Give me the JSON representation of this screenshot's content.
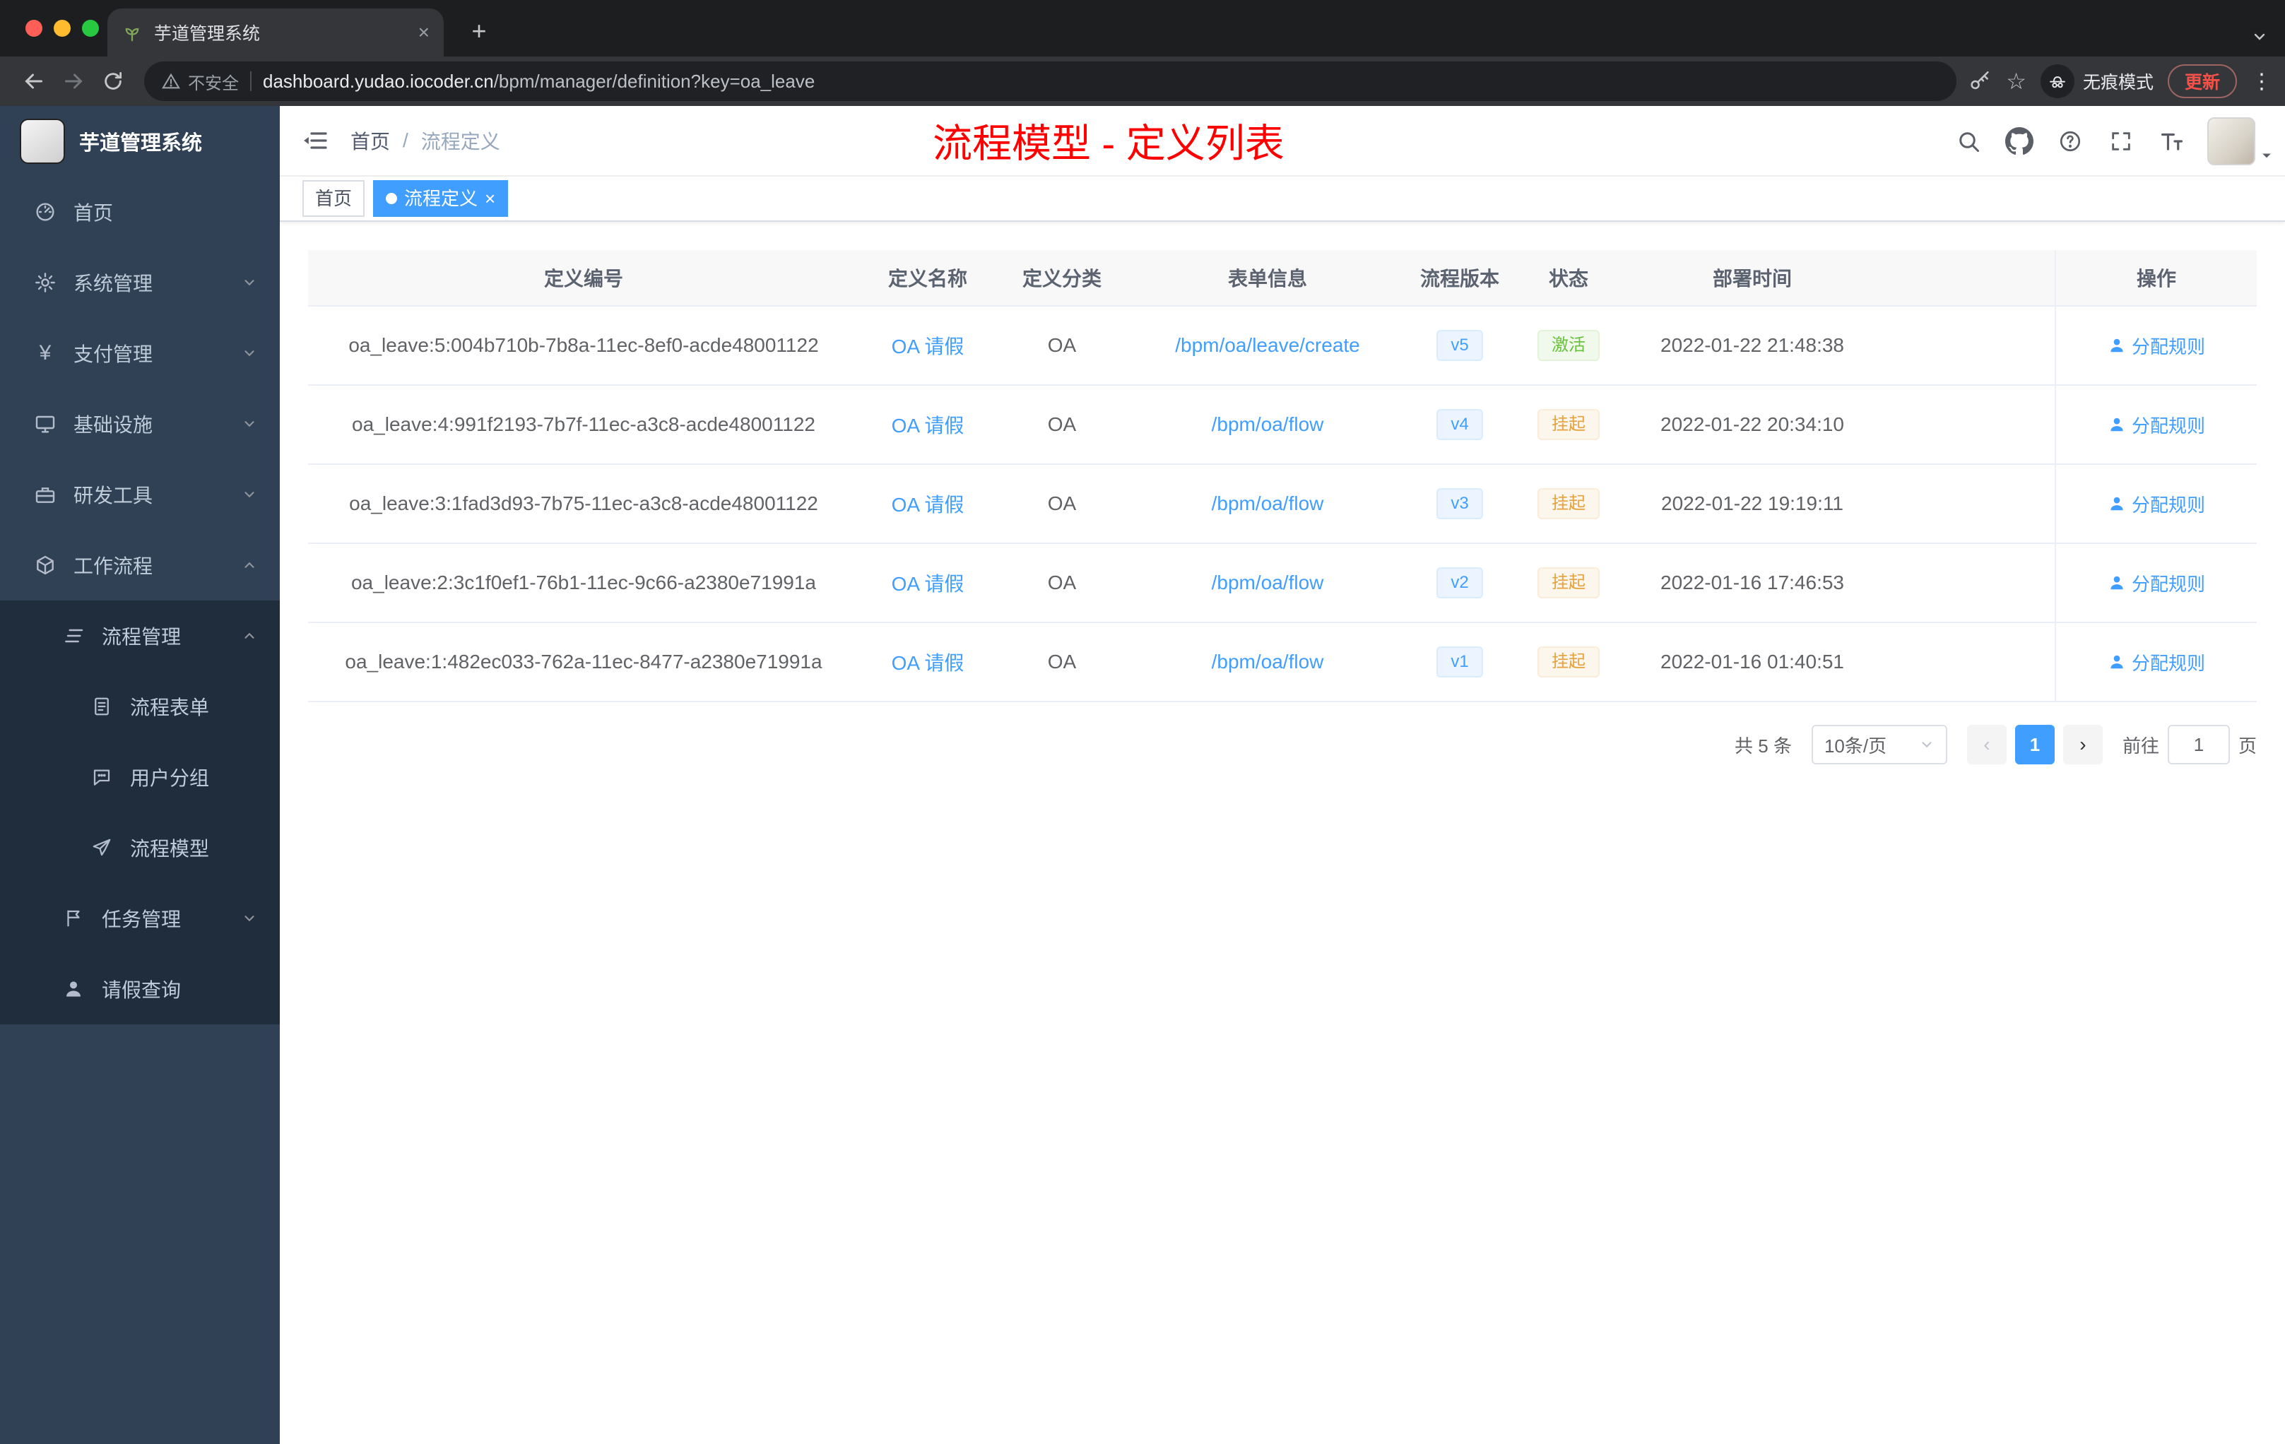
{
  "colors": {
    "accent": "#409eff",
    "success": "#67c23a",
    "warning": "#e6a23c",
    "annotation_red": "#ff0000",
    "sidebar_bg": "#304156",
    "sidebar_submenu_bg": "#1f2d3d"
  },
  "glyphs": {
    "close": "×",
    "plus": "+",
    "star": "☆",
    "kebab": "⋮",
    "yen": "¥",
    "prev": "‹",
    "next": "›"
  },
  "browser": {
    "tab_title": "芋道管理系统",
    "security_label": "不安全",
    "url_host": "dashboard.yudao.iocoder.cn",
    "url_path": "/bpm/manager/definition?key=oa_leave",
    "incognito_label": "无痕模式",
    "update_label": "更新"
  },
  "sidebar": {
    "title": "芋道管理系统",
    "menu": [
      {
        "label": "首页"
      },
      {
        "label": "系统管理"
      },
      {
        "label": "支付管理"
      },
      {
        "label": "基础设施"
      },
      {
        "label": "研发工具"
      },
      {
        "label": "工作流程"
      },
      {
        "label": "流程管理"
      },
      {
        "label": "流程表单"
      },
      {
        "label": "用户分组"
      },
      {
        "label": "流程模型"
      },
      {
        "label": "任务管理"
      },
      {
        "label": "请假查询"
      }
    ]
  },
  "header": {
    "breadcrumb_home": "首页",
    "breadcrumb_sep": "/",
    "breadcrumb_current": "流程定义",
    "annotation": "流程模型 - 定义列表"
  },
  "tags": [
    {
      "label": "首页"
    },
    {
      "label": "流程定义"
    }
  ],
  "table": {
    "columns": [
      "定义编号",
      "定义名称",
      "定义分类",
      "表单信息",
      "流程版本",
      "状态",
      "部署时间",
      "操作"
    ],
    "rows": [
      {
        "id": "oa_leave:5:004b710b-7b8a-11ec-8ef0-acde48001122",
        "name": "OA 请假",
        "category": "OA",
        "form": "/bpm/oa/leave/create",
        "version": "v5",
        "status": "激活",
        "time": "2022-01-22 21:48:38",
        "action": "分配规则"
      },
      {
        "id": "oa_leave:4:991f2193-7b7f-11ec-a3c8-acde48001122",
        "name": "OA 请假",
        "category": "OA",
        "form": "/bpm/oa/flow",
        "version": "v4",
        "status": "挂起",
        "time": "2022-01-22 20:34:10",
        "action": "分配规则"
      },
      {
        "id": "oa_leave:3:1fad3d93-7b75-11ec-a3c8-acde48001122",
        "name": "OA 请假",
        "category": "OA",
        "form": "/bpm/oa/flow",
        "version": "v3",
        "status": "挂起",
        "time": "2022-01-22 19:19:11",
        "action": "分配规则"
      },
      {
        "id": "oa_leave:2:3c1f0ef1-76b1-11ec-9c66-a2380e71991a",
        "name": "OA 请假",
        "category": "OA",
        "form": "/bpm/oa/flow",
        "version": "v2",
        "status": "挂起",
        "time": "2022-01-16 17:46:53",
        "action": "分配规则"
      },
      {
        "id": "oa_leave:1:482ec033-762a-11ec-8477-a2380e71991a",
        "name": "OA 请假",
        "category": "OA",
        "form": "/bpm/oa/flow",
        "version": "v1",
        "status": "挂起",
        "time": "2022-01-16 01:40:51",
        "action": "分配规则"
      }
    ]
  },
  "pagination": {
    "total": "共 5 条",
    "page_size": "10条/页",
    "page": "1",
    "goto": "前往",
    "goto_value": "1",
    "unit": "页"
  }
}
